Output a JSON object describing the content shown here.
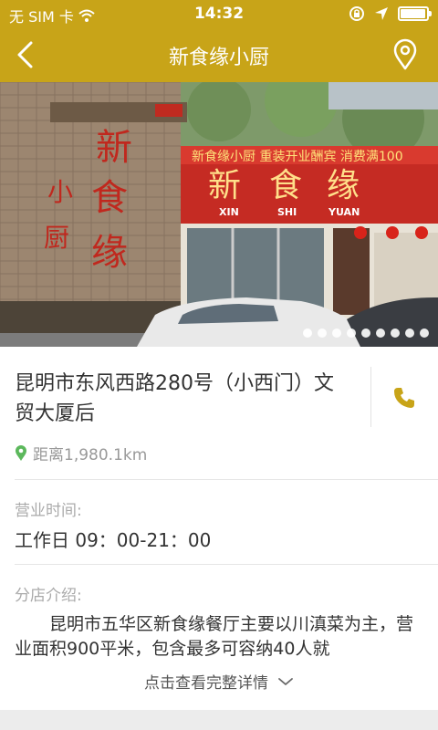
{
  "status_bar": {
    "carrier": "无 SIM 卡",
    "time": "14:32",
    "battery_level": 0.95
  },
  "nav": {
    "title": "新食缘小厨",
    "back_icon": "back-chevron-icon",
    "location_icon": "location-pin-icon"
  },
  "hero": {
    "sign_vertical": "新食缘",
    "sign_side": "小厨",
    "banner": "新食缘小厨 重装开业酬宾 消费满100",
    "store_chars": [
      "新",
      "食",
      "缘"
    ],
    "pinyin": [
      "XIN",
      "SHI",
      "YUAN"
    ],
    "slide_count": 9,
    "active_slide": 1
  },
  "store": {
    "address": "昆明市东风西路280号（小西门）文贸大厦后",
    "distance": "距离1,980.1km",
    "phone_icon": "phone-icon",
    "distance_icon": "map-marker-icon"
  },
  "hours": {
    "label": "营业时间:",
    "value": "工作日 09：00-21：00"
  },
  "intro": {
    "label": "分店介绍:",
    "text": "昆明市五华区新食缘餐厅主要以川滇菜为主，营业面积900平米，包含最多可容纳40人就",
    "more": "点击查看完整详情"
  },
  "colors": {
    "brand": "#c8a418",
    "text": "#333333",
    "muted": "#aaaaaa",
    "accent_green": "#5cb85c"
  }
}
